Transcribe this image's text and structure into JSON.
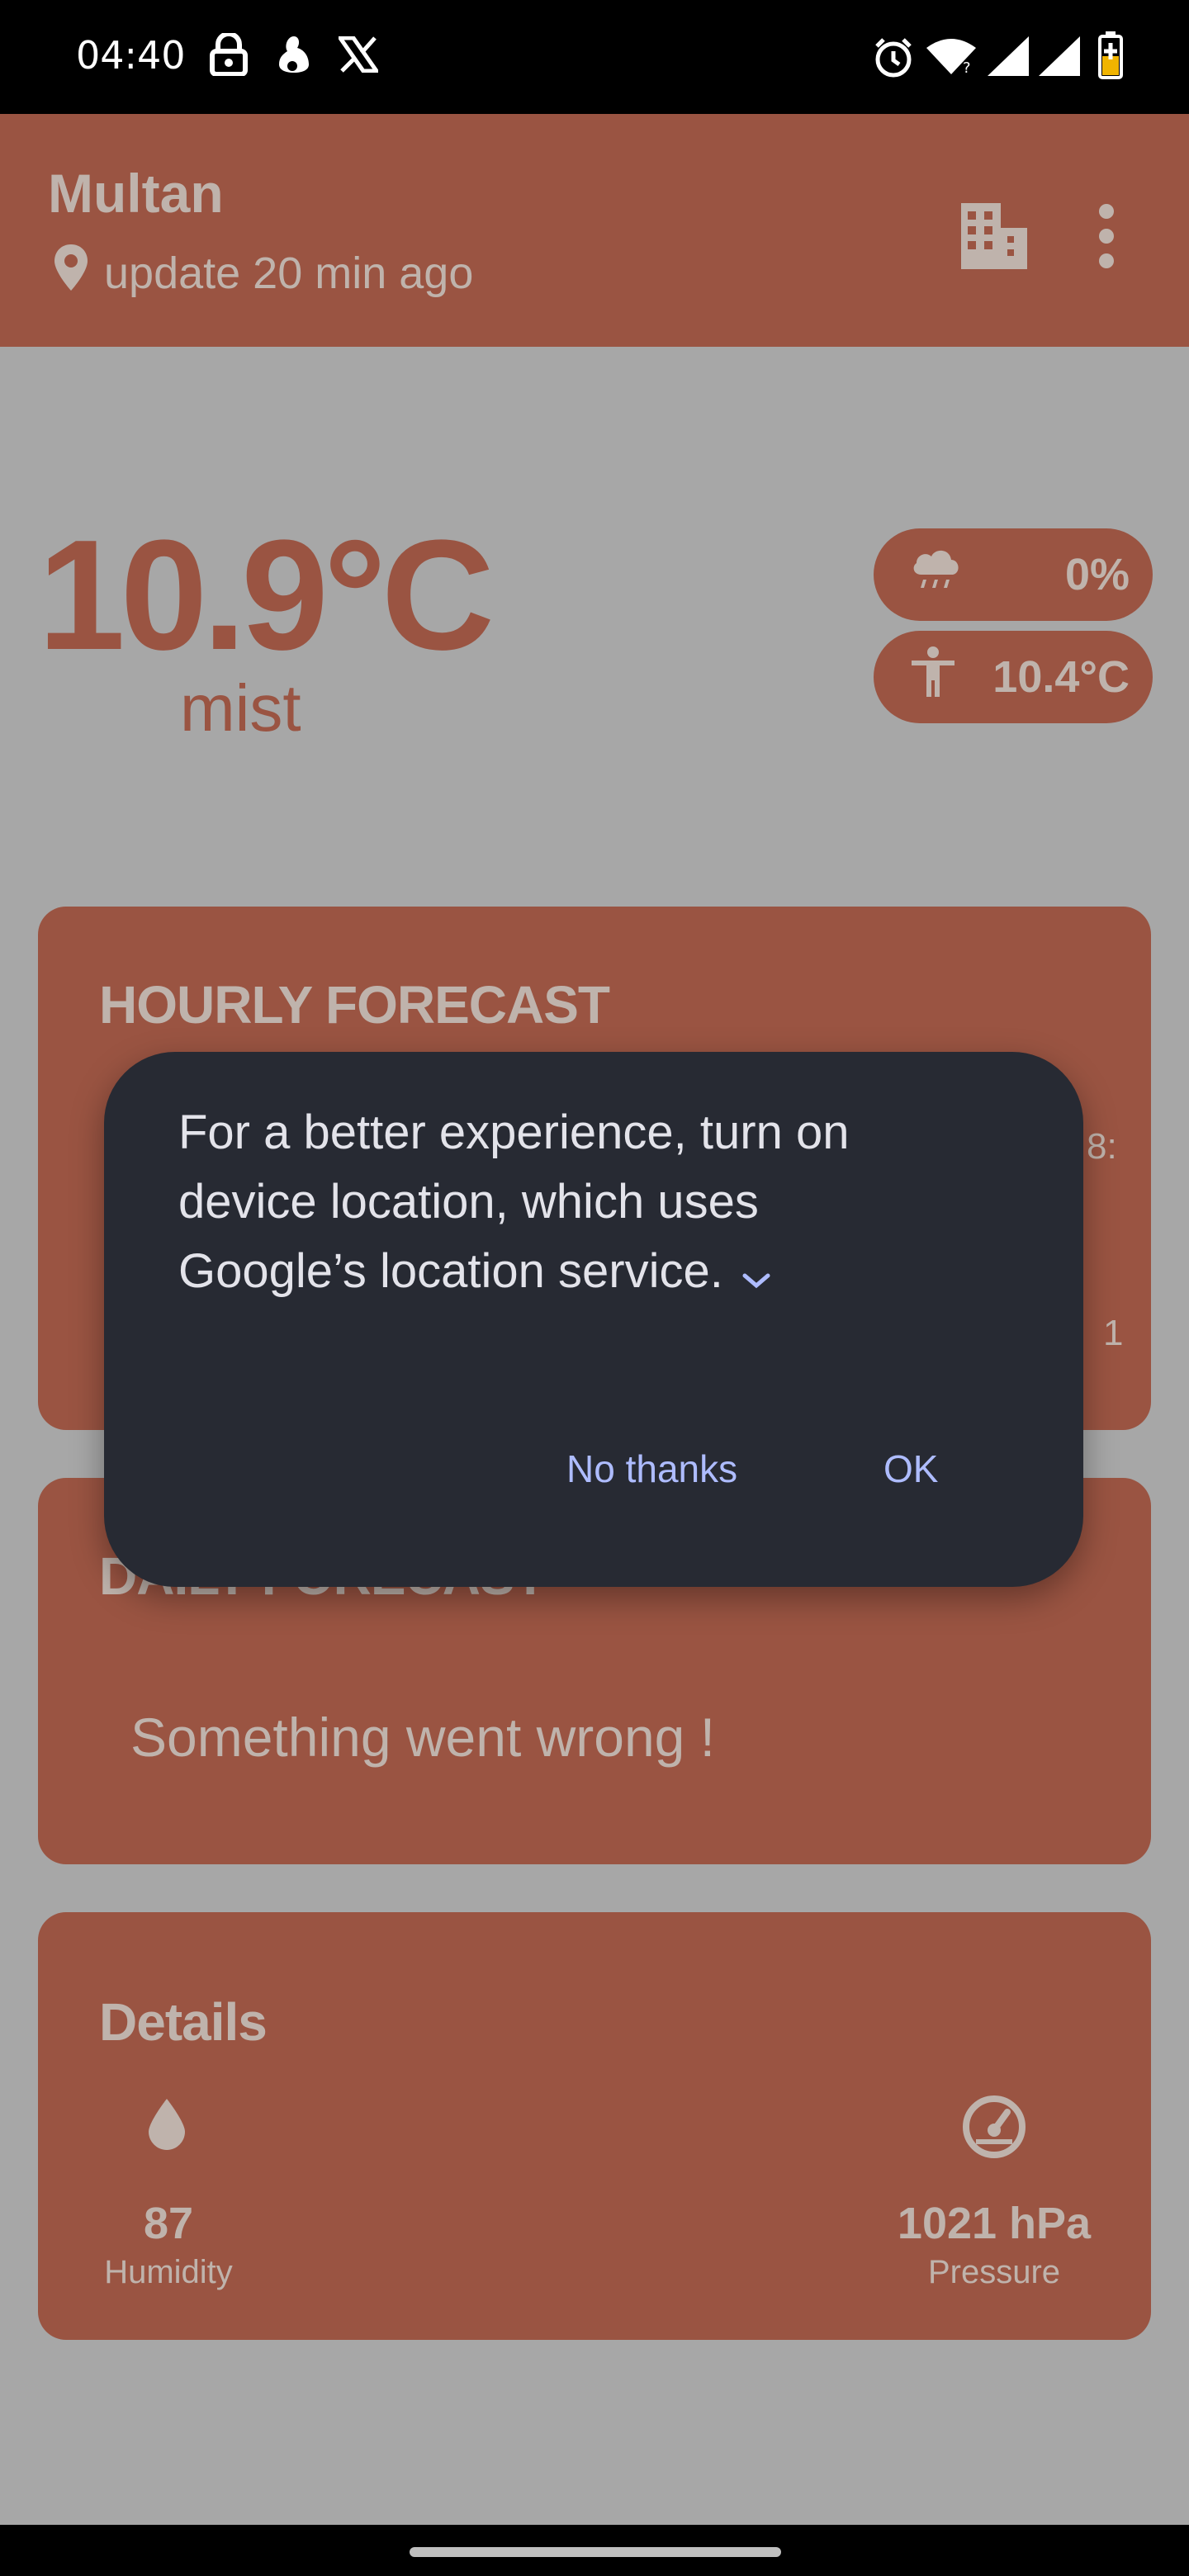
{
  "status_bar": {
    "time": "04:40",
    "icons": [
      "lock-icon",
      "app-notification-icon",
      "x-logo-icon",
      "alarm-icon",
      "wifi-icon",
      "signal-icon",
      "signal-icon",
      "battery-charging-icon"
    ]
  },
  "header": {
    "city": "Multan",
    "update_text": "update 20 min ago",
    "icons": [
      "location-pin-icon",
      "city-buildings-icon",
      "more-vert-icon"
    ]
  },
  "current": {
    "temperature": "10.9°C",
    "condition": "mist",
    "precipitation": "0%",
    "feels_like": "10.4°C"
  },
  "hourly": {
    "title": "HOURLY FORECAST",
    "peek_top": "8:",
    "peek_bottom": "1"
  },
  "daily": {
    "title": "DAILY FORECAST",
    "error": "Something went wrong !"
  },
  "details": {
    "title": "Details",
    "humidity_value": "87",
    "humidity_label": "Humidity",
    "pressure_value": "1021 hPa",
    "pressure_label": "Pressure"
  },
  "dialog": {
    "message": "For a better experience, turn on device location, which uses Google’s location service.",
    "no_label": "No thanks",
    "ok_label": "OK"
  },
  "colors": {
    "scrim": "#a7a7a7",
    "card": "#9a5442",
    "card_text": "#bfb3ac",
    "dialog_bg": "#272a33",
    "dialog_accent": "#aebcff"
  }
}
